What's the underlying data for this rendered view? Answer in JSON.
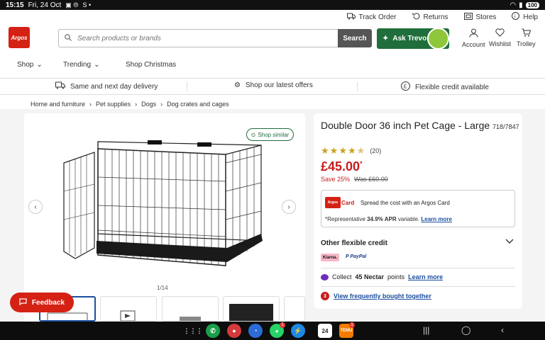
{
  "status_bar": {
    "time": "15:15",
    "date": "Fri, 24 Oct",
    "battery": "100"
  },
  "utility": [
    {
      "label": "Track Order",
      "icon": "truck-icon"
    },
    {
      "label": "Returns",
      "icon": "returns-icon"
    },
    {
      "label": "Stores",
      "icon": "store-icon"
    },
    {
      "label": "Help",
      "icon": "help-icon"
    }
  ],
  "header": {
    "logo_text": "Argos",
    "search_placeholder": "Search products or brands",
    "search_button": "Search",
    "ask_label": "Ask Trevor",
    "account": "Account",
    "wishlist": "Wishlist",
    "trolley": "Trolley"
  },
  "nav": {
    "shop": "Shop",
    "trending": "Trending",
    "christmas": "Shop Christmas"
  },
  "promo": {
    "delivery": "Same and next day delivery",
    "offers": "Shop our latest offers",
    "credit": "Flexible credit available"
  },
  "breadcrumb": [
    "Home and furniture",
    "Pet supplies",
    "Dogs",
    "Dog crates and cages"
  ],
  "product": {
    "title": "Double Door 36 inch Pet Cage - Large",
    "code": "718/7847",
    "rating": 4.5,
    "review_count": "(20)",
    "price": "£45.00",
    "price_mark": "*",
    "save": "Save 25%",
    "was": "Was £60.00",
    "shop_similar": "Shop similar",
    "image_counter": "1/14"
  },
  "argos_card": {
    "logo": "Argos",
    "card_label": "Card",
    "spread_text": "Spread the cost with an Argos Card",
    "rep_prefix": "*Representative",
    "apr": "34.9% APR",
    "rep_suffix": "variable.",
    "learn_more": "Learn more"
  },
  "credit": {
    "title": "Other flexible credit",
    "klarna": "Klarna.",
    "paypal": "PayPal"
  },
  "nectar": {
    "prefix": "Collect",
    "points": "45 Nectar",
    "suffix": "points",
    "learn_more": "Learn more"
  },
  "bought_together": {
    "number": "3",
    "label": "View frequently bought together"
  },
  "feedback": "Feedback",
  "taskbar": {
    "whatsapp_badge": "1",
    "calendar_day": "24",
    "temu_badge": "1"
  },
  "colors": {
    "brand_red": "#d42114",
    "price_red": "#c71c1c",
    "green": "#1f6e3b",
    "link_blue": "#1c4fa0"
  }
}
